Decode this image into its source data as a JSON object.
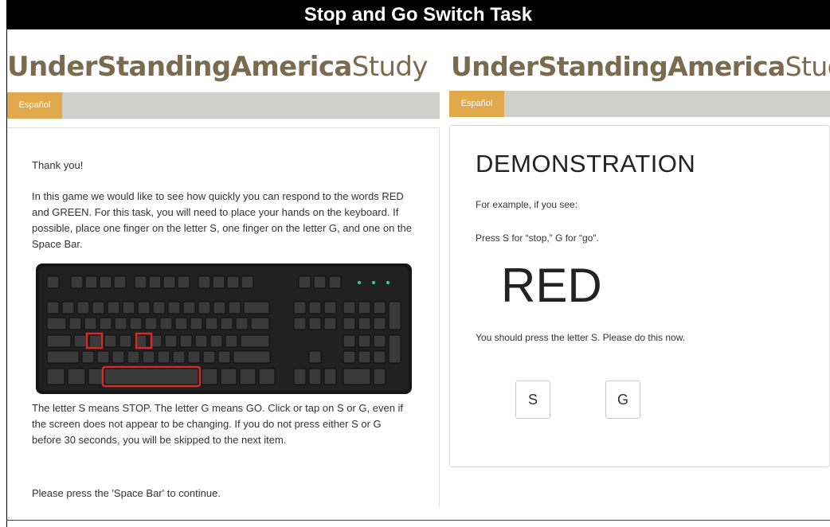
{
  "title": "Stop and Go Switch Task",
  "brand": {
    "bold": "UnderStandingAmerica",
    "light": "Study"
  },
  "language_button": "Español",
  "left_panel": {
    "thank_you": "Thank you!",
    "intro": "In this game we would like to see how quickly you can respond to the words RED and GREEN. For this task, you will need to place your hands on the keyboard. If possible, place one finger on the letter S, one finger on the letter G, and one on the Space Bar.",
    "meaning": "The letter S means STOP. The letter G means GO. Click or tap on S or G, even if the screen does not appear to be changing. If you do not press either S or G before 30 seconds, you will be skipped to the next item.",
    "continue": "Please press the 'Space Bar' to continue."
  },
  "right_panel": {
    "heading": "DEMONSTRATION",
    "example": "For example, if you see:",
    "press": "Press S for “stop,” G for “go”.",
    "stimulus": "RED",
    "instruction": "You should press the letter S. Please do this now.",
    "buttons": [
      "S",
      "G"
    ]
  },
  "colors": {
    "title_bg": "#000000",
    "brand": "#7a6a4f",
    "language_button": "#e0a94b",
    "language_bar": "#cfcfcc",
    "highlight": "#d42a2a"
  },
  "icons": {
    "keyboard": "keyboard-image"
  }
}
